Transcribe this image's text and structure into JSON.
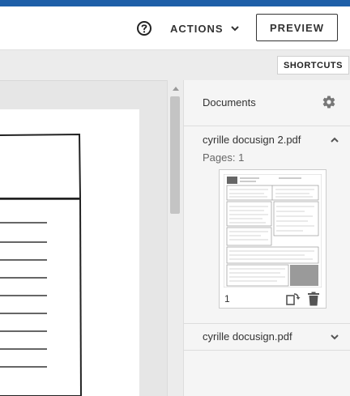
{
  "header": {
    "help_icon": "question-circle-icon",
    "actions_label": "ACTIONS",
    "preview_label": "PREVIEW"
  },
  "toolbar": {
    "shortcuts_label": "SHORTCUTS"
  },
  "sidebar": {
    "title": "Documents",
    "settings_icon": "gear-icon",
    "documents": [
      {
        "name": "cyrille docusign 2.pdf",
        "pages_label": "Pages: 1",
        "expanded": true,
        "thumbnail_page_number": "1"
      },
      {
        "name": "cyrille docusign.pdf",
        "expanded": false
      }
    ]
  },
  "colors": {
    "top_accent": "#1f5fa8",
    "viewer_bg": "#e6e6e6",
    "sidebar_bg": "#f5f5f5"
  }
}
